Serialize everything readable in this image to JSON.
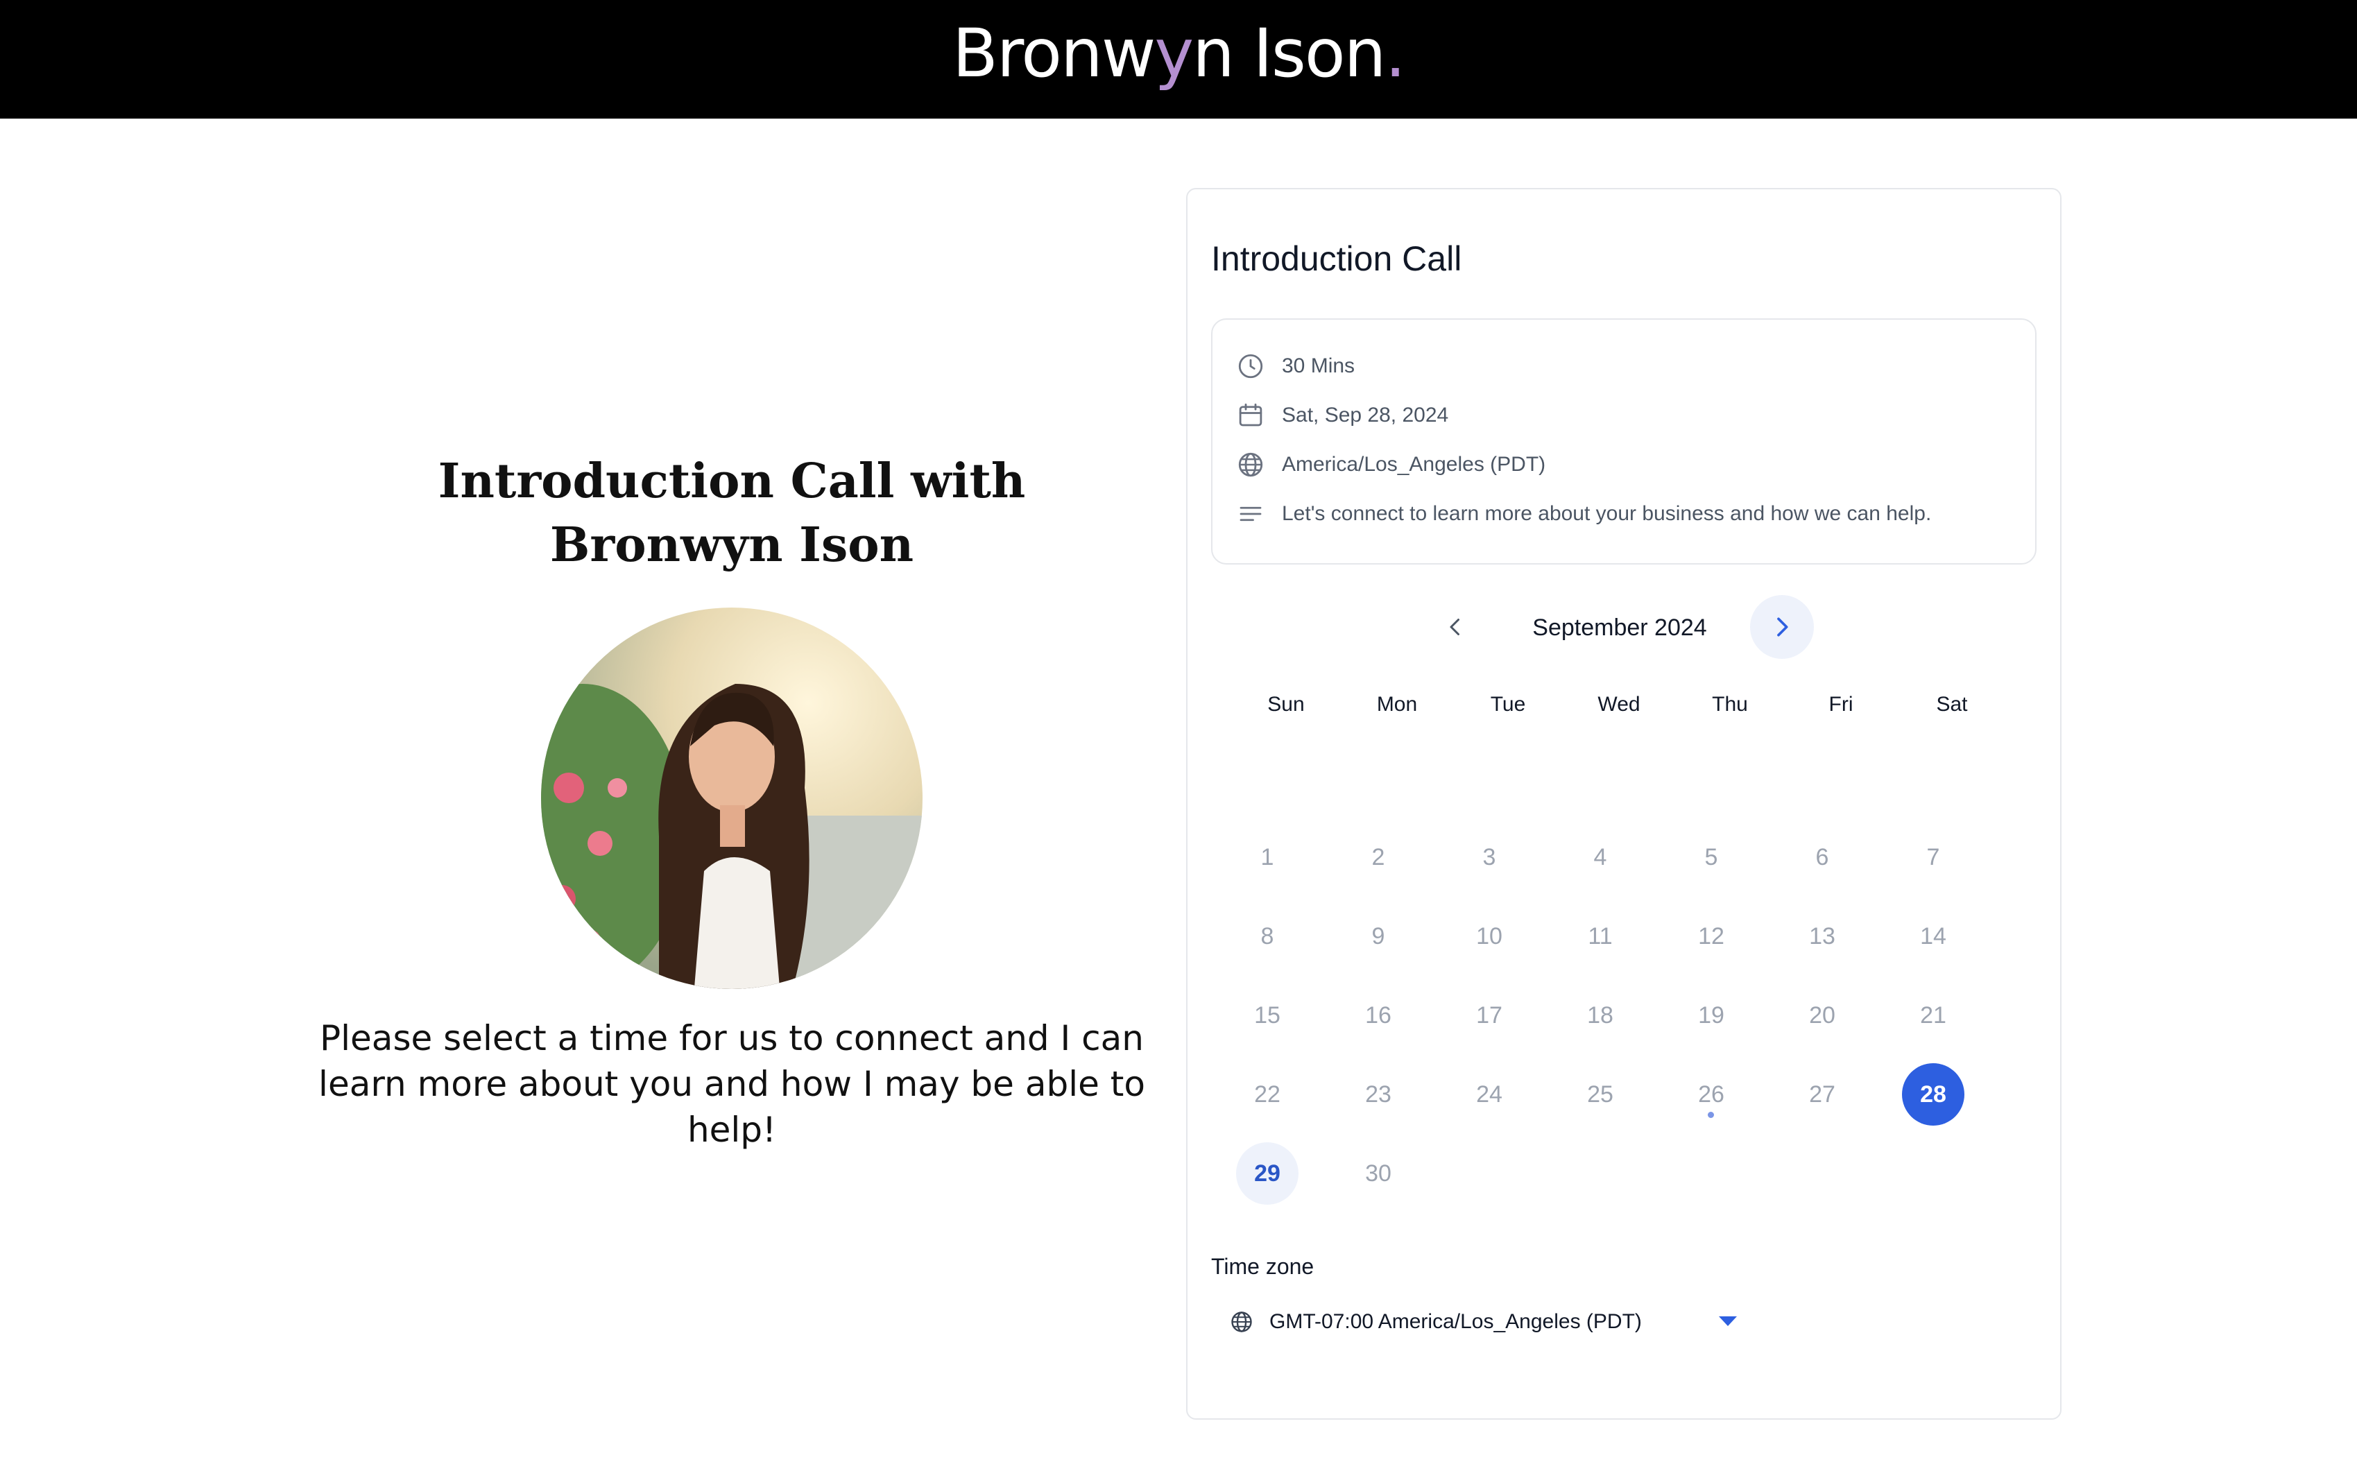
{
  "header": {
    "logo_main": "Bronw",
    "logo_y": "y",
    "logo_end": "n Ison",
    "logo_dot": "."
  },
  "intro": {
    "title_line1": "Introduction Call with",
    "title_line2": "Bronwyn Ison",
    "message_line1": "Please select a time for us to connect and I can",
    "message_line2": "learn more about you and how I may be able to",
    "message_line3": "help!"
  },
  "event": {
    "title": "Introduction Call",
    "duration": "30 Mins",
    "date": "Sat, Sep 28, 2024",
    "timezone": "America/Los_Angeles (PDT)",
    "description": "Let's connect to learn more about your business and how we can help."
  },
  "calendar": {
    "month_label": "September 2024",
    "weekdays": [
      "Sun",
      "Mon",
      "Tue",
      "Wed",
      "Thu",
      "Fri",
      "Sat"
    ],
    "days": [
      "1",
      "2",
      "3",
      "4",
      "5",
      "6",
      "7",
      "8",
      "9",
      "10",
      "11",
      "12",
      "13",
      "14",
      "15",
      "16",
      "17",
      "18",
      "19",
      "20",
      "21",
      "22",
      "23",
      "24",
      "25",
      "26",
      "27",
      "28",
      "29",
      "30"
    ],
    "selected_day": "28",
    "available_days": [
      "29"
    ],
    "today_marker_day": "26"
  },
  "timezone_field": {
    "label": "Time zone",
    "value": "GMT-07:00 America/Los_Angeles (PDT)"
  },
  "colors": {
    "accent": "#2d5fe0",
    "logo_accent": "#b48fd0"
  },
  "icons": [
    "clock-icon",
    "calendar-icon",
    "globe-icon",
    "description-lines-icon",
    "chevron-left-icon",
    "chevron-right-icon",
    "caret-down-icon"
  ]
}
